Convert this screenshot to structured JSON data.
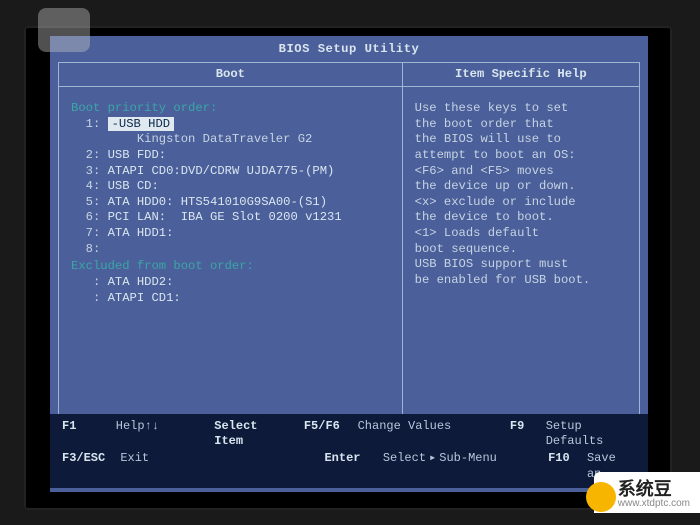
{
  "title": "BIOS Setup Utility",
  "panes": {
    "left_header": "Boot",
    "right_header": "Item Specific Help"
  },
  "boot": {
    "section_label": "Boot priority order:",
    "items": [
      {
        "idx": "1:",
        "label": "-USB HDD",
        "selected": true,
        "sub": "Kingston DataTraveler G2"
      },
      {
        "idx": "2:",
        "label": "USB FDD:"
      },
      {
        "idx": "3:",
        "label": "ATAPI CD0:DVD/CDRW UJDA775-(PM)"
      },
      {
        "idx": "4:",
        "label": "USB CD:"
      },
      {
        "idx": "5:",
        "label": "ATA HDD0: HTS541010G9SA00-(S1)"
      },
      {
        "idx": "6:",
        "label": "PCI LAN:  IBA GE Slot 0200 v1231"
      },
      {
        "idx": "7:",
        "label": "ATA HDD1:"
      },
      {
        "idx": "8:",
        "label": ""
      }
    ],
    "excluded_label": "Excluded from boot order:",
    "excluded": [
      {
        "idx": ":",
        "label": "ATA HDD2:"
      },
      {
        "idx": ":",
        "label": "ATAPI CD1:"
      }
    ]
  },
  "help": {
    "l1": "Use these keys to set",
    "l2": "the boot order that",
    "l3": "the BIOS will use to",
    "l4": "attempt to boot an OS:",
    "l5": "<F6> and <F5> moves",
    "l6": "the device up or down.",
    "l7": "<x> exclude or include",
    "l8": "the device to boot.",
    "l9": "<1> Loads default",
    "l10": "boot sequence.",
    "l11": "USB BIOS support must",
    "l12": "be enabled for USB boot."
  },
  "footer": {
    "r1": {
      "k1": "F1",
      "a1": "Help↑↓",
      "k2": "Select Item",
      "spacer": "",
      "k3": "F5/F6",
      "a3": "Change Values",
      "k4": "F9",
      "a4": "Setup Defaults"
    },
    "r2": {
      "k1": "F3/ESC",
      "a1": "Exit",
      "k3": "Enter",
      "a3pre": "Select",
      "a3post": "Sub-Menu",
      "k4": "F10",
      "a4": "Save an"
    }
  },
  "watermark": {
    "brand": "系统豆",
    "url": "www.xtdptc.com"
  }
}
